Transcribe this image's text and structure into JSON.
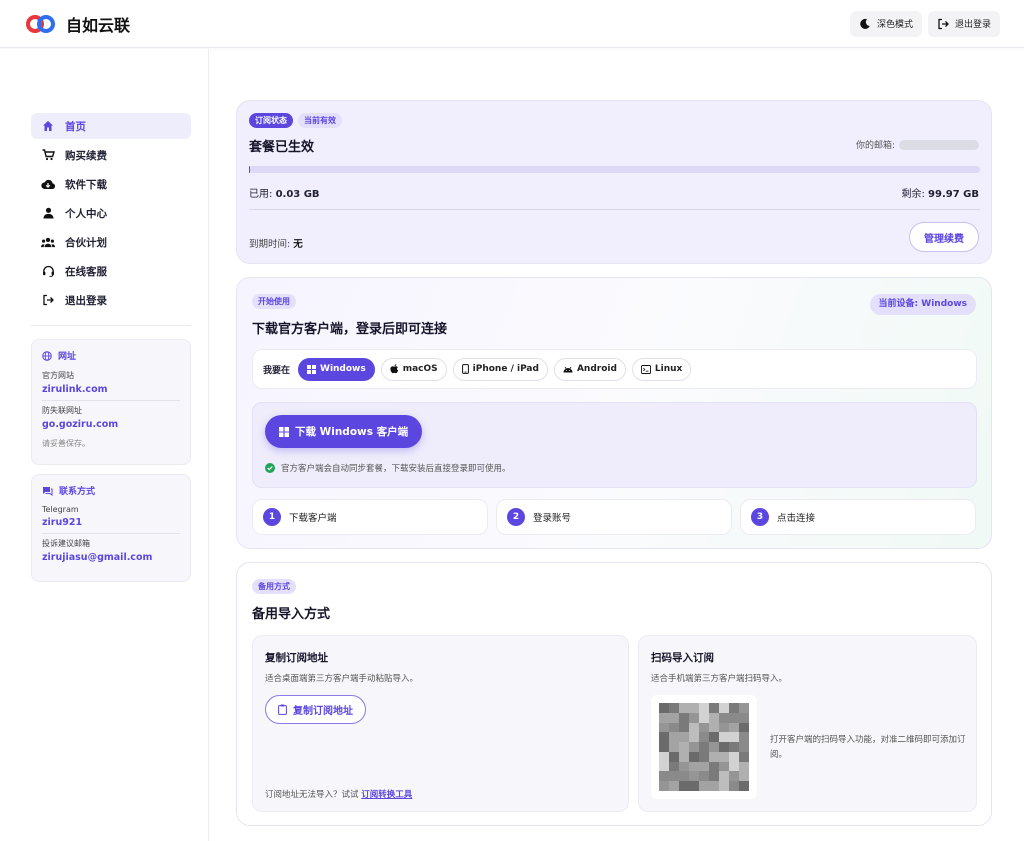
{
  "app": {
    "title": "自如云联"
  },
  "topbar": {
    "dark_mode_label": "深色模式",
    "logout_label": "退出登录"
  },
  "sidebar": {
    "items": [
      {
        "label": "首页",
        "icon": "home-icon",
        "active": true
      },
      {
        "label": "购买续费",
        "icon": "cart-icon",
        "active": false
      },
      {
        "label": "软件下载",
        "icon": "cloud-download-icon",
        "active": false
      },
      {
        "label": "个人中心",
        "icon": "user-icon",
        "active": false
      },
      {
        "label": "合伙计划",
        "icon": "group-icon",
        "active": false
      },
      {
        "label": "在线客服",
        "icon": "headset-icon",
        "active": false
      },
      {
        "label": "退出登录",
        "icon": "logout-icon",
        "active": false
      }
    ],
    "sites": {
      "title": "网址",
      "official_label": "官方网站",
      "official_value": "zirulink.com",
      "backup_label": "防失联网址",
      "backup_value": "go.goziru.com",
      "note": "请妥善保存。"
    },
    "contact": {
      "title": "联系方式",
      "telegram_label": "Telegram",
      "telegram_value": "ziru921",
      "email_label": "投诉建议邮箱",
      "email_value": "zirujiasu@gmail.com"
    }
  },
  "subscription": {
    "status_badge": "订阅状态",
    "valid_badge": "当前有效",
    "title": "套餐已生效",
    "email_label": "你的邮箱:",
    "used_label": "已用:",
    "used_value": "0.03 GB",
    "remaining_label": "剩余:",
    "remaining_value": "99.97 GB",
    "usage_fraction": 0.0003,
    "expiry_label": "到期时间:",
    "expiry_value": "无",
    "manage_button": "管理续费"
  },
  "getting_started": {
    "badge": "开始使用",
    "device_label": "当前设备: Windows",
    "title": "下载官方客户端，登录后即可连接",
    "platform_prefix": "我要在",
    "platforms": [
      "Windows",
      "macOS",
      "iPhone / iPad",
      "Android",
      "Linux"
    ],
    "download_button": "下载 Windows 客户端",
    "download_note": "官方客户端会自动同步套餐，下载安装后直接登录即可使用。",
    "steps": [
      {
        "num": "1",
        "label": "下载客户端"
      },
      {
        "num": "2",
        "label": "登录账号"
      },
      {
        "num": "3",
        "label": "点击连接"
      }
    ]
  },
  "backup": {
    "badge": "备用方式",
    "title": "备用导入方式",
    "copy": {
      "title": "复制订阅地址",
      "desc": "适合桌面端第三方客户端手动粘贴导入。",
      "button": "复制订阅地址",
      "hint_prefix": "订阅地址无法导入？试试",
      "hint_link": "订阅转换工具"
    },
    "scan": {
      "title": "扫码导入订阅",
      "desc": "适合手机端第三方客户端扫码导入。",
      "instruction": "打开客户端的扫码导入功能，对准二维码即可添加订阅。"
    }
  },
  "colors": {
    "accent": "#5b47e0",
    "success": "#22a55a"
  }
}
